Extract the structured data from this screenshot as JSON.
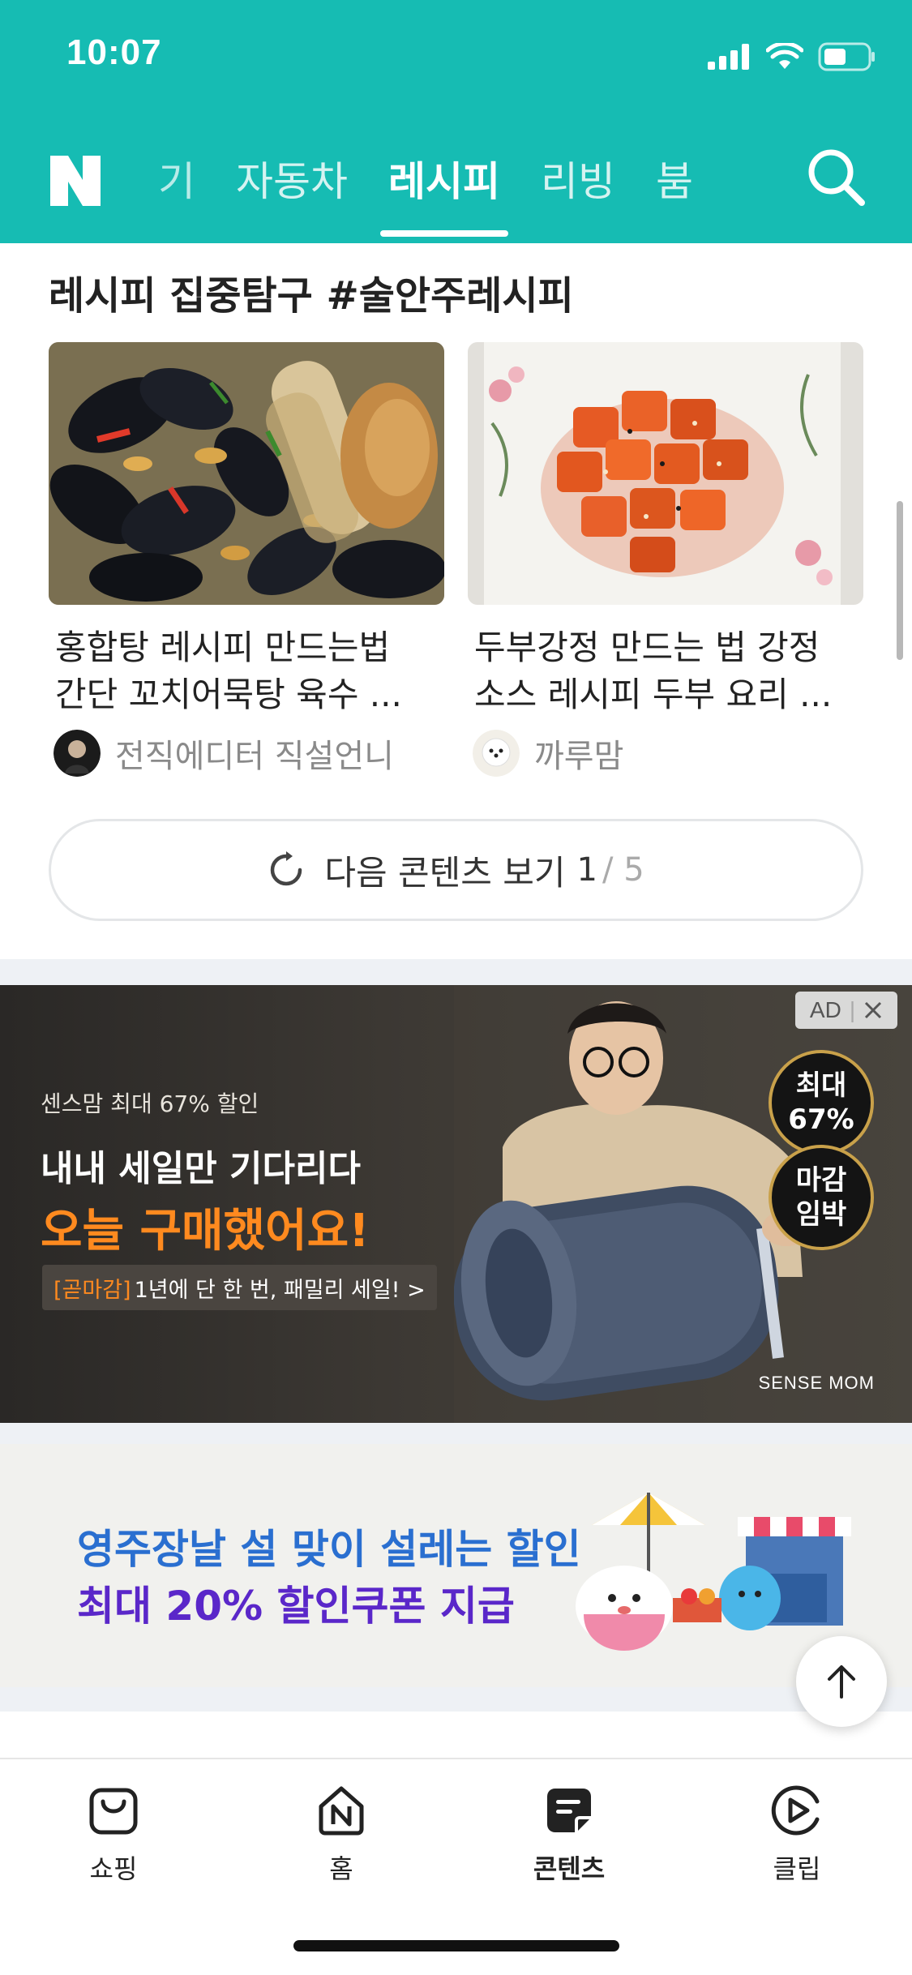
{
  "status_bar": {
    "time": "10:07",
    "icons": [
      "signal-icon",
      "wifi-icon",
      "battery-icon"
    ]
  },
  "header": {
    "logo": "N",
    "tabs": [
      {
        "label": "기",
        "active": false
      },
      {
        "label": "자동차",
        "active": false
      },
      {
        "label": "레시피",
        "active": true
      },
      {
        "label": "리빙",
        "active": false
      },
      {
        "label": "붐",
        "active": false
      }
    ],
    "search_icon": "search-icon",
    "accent_color": "#16bcb3"
  },
  "recipe_section": {
    "title": "레시피 집중탐구 #술안주레시피",
    "cards": [
      {
        "title_line1": "홍합탕 레시피 만드는법",
        "title_line2": "간단 꼬치어묵탕 육수 ...",
        "author": "전직에디터 직설언니"
      },
      {
        "title_line1": "두부강정 만드는 법 강정",
        "title_line2": "소스 레시피 두부 요리 ...",
        "author": "까루맘"
      }
    ],
    "next_button": {
      "label": "다음 콘텐츠 보기",
      "current": "1",
      "separator": "/ 5"
    }
  },
  "ad_banner": {
    "tag": "AD",
    "small": "센스맘 최대 67% 할인",
    "headline1": "내내 세일만 기다리다",
    "headline2": "오늘 구매했어요!",
    "pill_highlight": "[곧마감]",
    "pill_text": "1년에 단 한 번, 패밀리 세일! >",
    "badge1_line1": "최대",
    "badge1_line2": "67%",
    "badge2_line1": "마감",
    "badge2_line2": "임박",
    "brand": "SENSE MOM"
  },
  "promo_banner": {
    "line1": "영주장날 설 맞이 설레는 할인",
    "line2": "최대 20% 할인쿠폰 지급"
  },
  "bottom_nav": [
    {
      "label": "쇼핑",
      "icon": "shopping-bag-icon",
      "active": false
    },
    {
      "label": "홈",
      "icon": "home-icon",
      "active": false
    },
    {
      "label": "콘텐츠",
      "icon": "contents-icon",
      "active": true
    },
    {
      "label": "클립",
      "icon": "clip-icon",
      "active": false
    }
  ]
}
